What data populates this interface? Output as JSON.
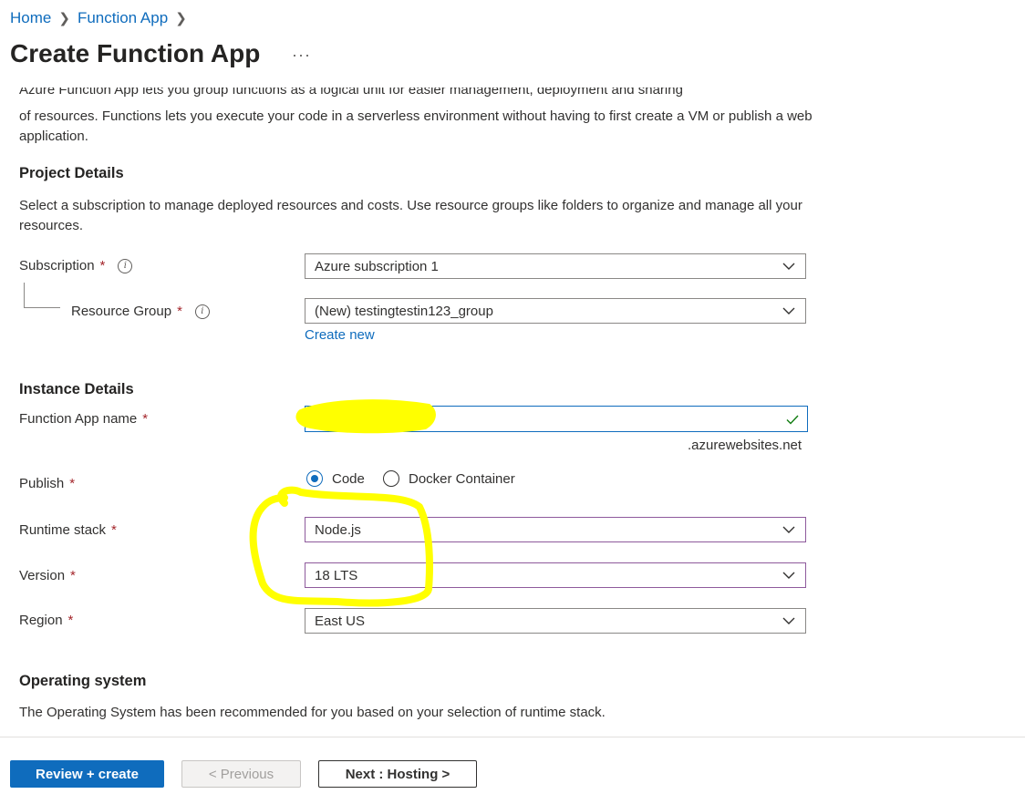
{
  "breadcrumb": {
    "items": [
      {
        "label": "Home"
      },
      {
        "label": "Function App"
      }
    ]
  },
  "page": {
    "title": "Create Function App",
    "more_label": "···"
  },
  "intro": {
    "cut_line": "Azure Function App lets you group functions as a logical unit for easier management, deployment and sharing",
    "text": "of resources. Functions lets you execute your code in a serverless environment without having to first create a VM or publish a web application."
  },
  "project_details": {
    "heading": "Project Details",
    "description": "Select a subscription to manage deployed resources and costs. Use resource groups like folders to organize and manage all your resources.",
    "subscription": {
      "label": "Subscription",
      "value": "Azure subscription 1"
    },
    "resource_group": {
      "label": "Resource Group",
      "value": "(New) testingtestin123_group",
      "create_new": "Create new"
    }
  },
  "instance_details": {
    "heading": "Instance Details",
    "function_app_name": {
      "label": "Function App name",
      "suffix": ".azurewebsites.net"
    },
    "publish": {
      "label": "Publish",
      "options": [
        "Code",
        "Docker Container"
      ],
      "selected": "Code"
    },
    "runtime_stack": {
      "label": "Runtime stack",
      "value": "Node.js"
    },
    "version": {
      "label": "Version",
      "value": "18 LTS"
    },
    "region": {
      "label": "Region",
      "value": "East US"
    }
  },
  "operating_system": {
    "heading": "Operating system",
    "description": "The Operating System has been recommended for you based on your selection of runtime stack."
  },
  "footer": {
    "review_create": "Review + create",
    "previous": "< Previous",
    "next": "Next : Hosting >"
  },
  "required_marker": "*",
  "colors": {
    "accent": "#0f6cbd",
    "required": "#a4262c",
    "highlight": "#ffff00",
    "valid_check": "#107c10"
  }
}
